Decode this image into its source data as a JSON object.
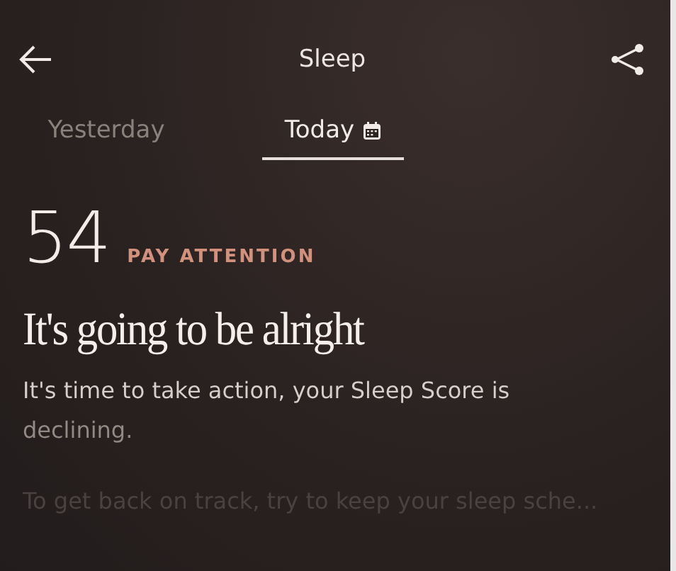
{
  "header": {
    "title": "Sleep"
  },
  "tabs": [
    {
      "label": "Yesterday",
      "selected": false,
      "calendar": false
    },
    {
      "label": "Today",
      "selected": true,
      "calendar": true
    }
  ],
  "score": {
    "value": "54",
    "status": "PAY ATTENTION"
  },
  "headline": "It's going to be alright",
  "message": "It's time to take action, your Sleep Score is declining.",
  "tip": "To get back on track, try to keep your sleep sche..."
}
